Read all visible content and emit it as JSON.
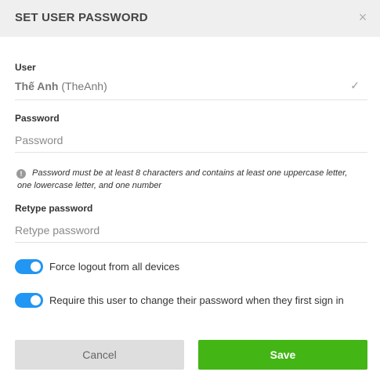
{
  "dialog": {
    "title": "SET USER PASSWORD",
    "close_symbol": "×"
  },
  "user": {
    "label": "User",
    "display_name": "Thế Anh",
    "username": "(TheAnh)",
    "check_symbol": "✓"
  },
  "password": {
    "label": "Password",
    "value": "",
    "placeholder": "Password"
  },
  "hint": {
    "icon_symbol": "!",
    "line1": "Password must be at least 8 characters and contains at least one uppercase letter,",
    "line2": "one lowercase letter, and one number"
  },
  "retype": {
    "label": "Retype password",
    "value": "",
    "placeholder": "Retype password"
  },
  "toggles": {
    "force_logout": {
      "label": "Force logout from all devices",
      "checked": true
    },
    "require_change": {
      "label": "Require this user to change their password when they first sign in",
      "checked": true
    }
  },
  "buttons": {
    "cancel": "Cancel",
    "save": "Save"
  },
  "colors": {
    "toggle_on": "#2196f3",
    "save_button": "#43b515",
    "cancel_button": "#dedede",
    "header_background": "#efefef"
  }
}
